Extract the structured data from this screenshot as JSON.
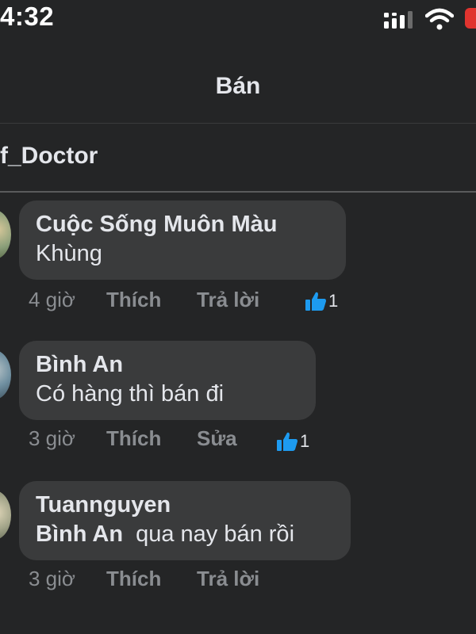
{
  "status_bar": {
    "time": "4:32"
  },
  "header": {
    "title": "Bán"
  },
  "subheader": {
    "title": "f_Doctor"
  },
  "comments": [
    {
      "author": "Cuộc Sống Muôn Màu",
      "text": "Khùng",
      "time": "4 giờ",
      "like_label": "Thích",
      "reply_label": "Trả lời",
      "reaction_count": "1"
    },
    {
      "author": "Bình An",
      "text": "Có hàng thì bán đi",
      "time": "3 giờ",
      "like_label": "Thích",
      "reply_label": "Sửa",
      "reaction_count": "1"
    },
    {
      "author": "Tuannguyen",
      "mention": "Bình An",
      "text": "qua nay bán rồi",
      "time": "3 giờ",
      "like_label": "Thích",
      "reply_label": "Trả lời"
    }
  ],
  "icons": {
    "reaction": "thumbs-up-icon",
    "signal": "cellular-signal-icon",
    "wifi": "wifi-icon",
    "battery": "battery-icon"
  },
  "colors": {
    "background": "#242526",
    "bubble": "#3a3b3c",
    "like_blue": "#1d9bf0",
    "muted": "#8a8d91"
  }
}
